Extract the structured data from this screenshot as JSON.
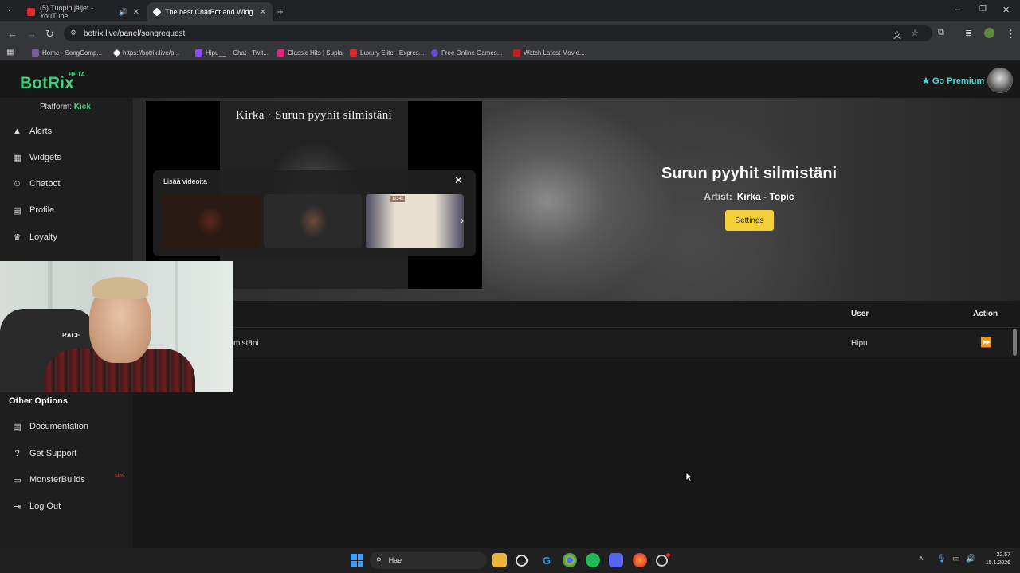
{
  "browser": {
    "tabs": [
      {
        "label": "(5) Tuopin jäljet - YouTube",
        "icon_color": "#e2232a"
      },
      {
        "label": "The best ChatBot and Widgets f",
        "icon_color": "#ffffff"
      }
    ],
    "url": "botrix.live/panel/songrequest",
    "bookmarks": [
      {
        "label": "Home - SongComp...",
        "icon_color": "#7a5aa0"
      },
      {
        "label": "https://botrix.live/p...",
        "icon_color": "#ffffff"
      },
      {
        "label": "Hipu__ – Chat - Twit...",
        "icon_color": "#9146ff"
      },
      {
        "label": "Classic Hits | Supla",
        "icon_color": "#e0287a"
      },
      {
        "label": "Luxury Elite - Expres...",
        "icon_color": "#e2232a"
      },
      {
        "label": "Free Online Games...",
        "icon_color": "#6a4ad0"
      },
      {
        "label": "Watch Latest Movie...",
        "icon_color": "#c02020"
      }
    ]
  },
  "app": {
    "logo": "BotRix",
    "beta": "BETA",
    "premium": "Go Premium",
    "platform_label": "Platform:",
    "platform_value": "Kick",
    "nav": [
      "Alerts",
      "Widgets",
      "Chatbot",
      "Profile",
      "Loyalty"
    ],
    "other_options_title": "Other Options",
    "other_nav": [
      "Documentation",
      "Get Support",
      "MonsterBuilds",
      "Log Out"
    ],
    "new_tag": "NEW"
  },
  "player": {
    "cover_title": "Kirka · Surun pyyhit silmistäni",
    "more_videos_label": "Lisää videoita",
    "thumb_tag": "12345"
  },
  "now_playing": {
    "title": "Surun pyyhit silmistäni",
    "artist_label": "Artist:",
    "artist": "Kirka - Topic",
    "settings_button": "Settings"
  },
  "queue": {
    "headers": {
      "user": "User",
      "action": "Action"
    },
    "rows": [
      {
        "song": "mistäni",
        "user": "Hipu"
      }
    ]
  },
  "webcam": {
    "chair_text": "RACE"
  },
  "taskbar": {
    "search_placeholder": "Hae",
    "time": "22.57",
    "date": "15.1.2026"
  },
  "colors": {
    "brand": "#3fd17d",
    "settings": "#f2cf3b",
    "premium": "#4fd6d6"
  }
}
